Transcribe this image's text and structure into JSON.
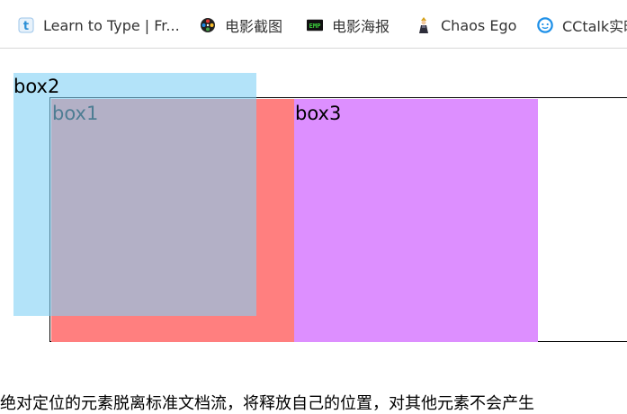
{
  "bookmarks": [
    {
      "label": "Learn to Type | Fr...",
      "icon": "typing-club-icon"
    },
    {
      "label": "电影截图",
      "icon": "film-reel-icon"
    },
    {
      "label": "电影海报",
      "icon": "emp-poster-icon"
    },
    {
      "label": "Chaos Ego",
      "icon": "chaos-ego-figure-icon"
    },
    {
      "label": "CCtalk实时",
      "icon": "cctalk-icon"
    }
  ],
  "demo": {
    "box1_label": "box1",
    "box2_label": "box2",
    "box3_label": "box3",
    "colors": {
      "box1": "#ff7f7f",
      "box2": "#80d0f5",
      "box3": "#dd8fff"
    }
  },
  "caption": "绝对定位的元素脱离标准文档流，将释放自己的位置，对其他元素不会产生"
}
